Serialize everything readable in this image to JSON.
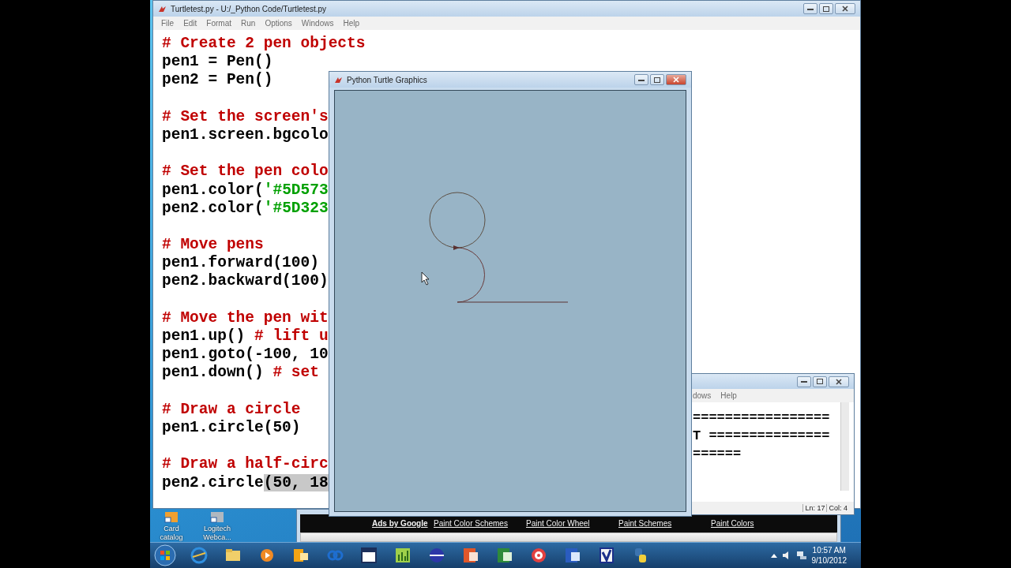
{
  "editor": {
    "title": "Turtletest.py - U:/_Python Code/Turtletest.py",
    "menu": [
      "File",
      "Edit",
      "Format",
      "Run",
      "Options",
      "Windows",
      "Help"
    ],
    "code_blocks": [
      [
        [
          {
            "kind": "comment",
            "text": "# Create 2 pen objects"
          }
        ],
        [
          {
            "kind": "code",
            "text": "pen1 = Pen()"
          }
        ],
        [
          {
            "kind": "code",
            "text": "pen2 = Pen()"
          }
        ]
      ],
      [
        [
          {
            "kind": "comment",
            "text": "# Set the screen's"
          }
        ],
        [
          {
            "kind": "code",
            "text": "pen1.screen.bgcolo"
          }
        ]
      ],
      [
        [
          {
            "kind": "comment",
            "text": "# Set the pen colo"
          }
        ],
        [
          {
            "kind": "code",
            "text": "pen1.color("
          },
          {
            "kind": "string",
            "text": "'#5D573"
          }
        ],
        [
          {
            "kind": "code",
            "text": "pen2.color("
          },
          {
            "kind": "string",
            "text": "'#5D323"
          }
        ]
      ],
      [
        [
          {
            "kind": "comment",
            "text": "# Move pens"
          }
        ],
        [
          {
            "kind": "code",
            "text": "pen1.forward(100)"
          }
        ],
        [
          {
            "kind": "code",
            "text": "pen2.backward(100)"
          }
        ]
      ],
      [
        [
          {
            "kind": "comment",
            "text": "# Move the pen wit"
          }
        ],
        [
          {
            "kind": "code",
            "text": "pen1.up() "
          },
          {
            "kind": "comment",
            "text": "# lift u"
          }
        ],
        [
          {
            "kind": "code",
            "text": "pen1.goto(-100, 10"
          }
        ],
        [
          {
            "kind": "code",
            "text": "pen1.down() "
          },
          {
            "kind": "comment",
            "text": "# set"
          }
        ]
      ],
      [
        [
          {
            "kind": "comment",
            "text": "# Draw a circle"
          }
        ],
        [
          {
            "kind": "code",
            "text": "pen1.circle(50)"
          }
        ]
      ],
      [
        [
          {
            "kind": "comment",
            "text": "# Draw a half-circ"
          }
        ],
        [
          {
            "kind": "code",
            "text": "pen2.circle"
          },
          {
            "kind": "selection",
            "text": "(50, 18"
          }
        ]
      ]
    ]
  },
  "turtle_window": {
    "title": "Python Turtle Graphics"
  },
  "shell_window": {
    "menu": [
      "dows",
      "Help"
    ],
    "lines": [
      "=================",
      "T ===============",
      "======"
    ],
    "status": [
      "Ln: 17",
      "Col: 4"
    ]
  },
  "browser": {
    "links": [
      {
        "kind": "label",
        "text": "Ads by Google"
      },
      {
        "kind": "link",
        "text": "Paint Color Schemes"
      },
      {
        "kind": "link",
        "text": "Paint Color Wheel"
      },
      {
        "kind": "link",
        "text": "Paint Schemes"
      },
      {
        "kind": "link",
        "text": "Paint Colors"
      }
    ]
  },
  "desktop_icons": [
    {
      "label": "Card catalog"
    },
    {
      "label": "Logitech Webca..."
    }
  ],
  "tray": {
    "time": "10:57 AM",
    "date": "9/10/2012"
  }
}
